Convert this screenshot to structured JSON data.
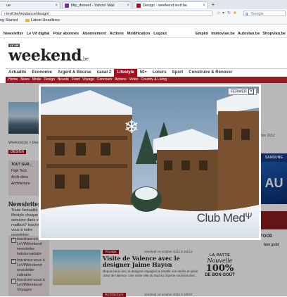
{
  "browser": {
    "tabs": [
      {
        "label": "ue",
        "active": false
      },
      {
        "label": "filip_deneef - Yahoo! Mail",
        "active": false
      },
      {
        "label": "Design - weekend.levif.be",
        "active": true
      }
    ],
    "url": "r.levif.be/tendance/design/",
    "search_placeholder": "Google",
    "bookmarks": [
      "ng Started",
      "Latest Headlines"
    ]
  },
  "site": {
    "topnav_left": [
      "Newsletter",
      "Le Vif digital",
      "Pour abonnés",
      "Abonnement",
      "Actions",
      "Modification",
      "Logout"
    ],
    "topnav_right": [
      "Emploi",
      "Immovlan.be",
      "Autovlan.be",
      "Shopvlan.be"
    ],
    "logo": {
      "badge": "LE VIF",
      "main": "weekend",
      "suffix": ".be"
    },
    "mainnav": [
      "Actualité",
      "Economie",
      "Argent & Bourse",
      "canal Z",
      "Lifestyle",
      "50+",
      "Loisirs",
      "Sport",
      "Construire & Rénover"
    ],
    "mainnav_active": "Lifestyle",
    "subnav": [
      "Home",
      "News",
      "Mode",
      "Design",
      "Beauté",
      "Food",
      "Voyage",
      "Concours",
      "Actions",
      "Video",
      "Country & Living"
    ],
    "breadcrumb": "Weekend.be > Design",
    "design_tag": "DESIGN",
    "tout_sur": {
      "title": "TOUT SUR...",
      "items": [
        "High Tech",
        "Archi-déco",
        "Architecture"
      ]
    },
    "newsletter": {
      "title": "Newsletter",
      "text": "Toute l'actualité lifestyle chaque semaine dans votre mailbox? Inscrivez-vous à notre newsletter.",
      "options": [
        "Inscrivez-vous à LeVifWeekend newsletter hebdomadaire",
        "Inscrivez-vous à LeVifWeekend newsletter culinaire",
        "Inscrivez-vous à LeVifWeekend Voyages"
      ]
    },
    "right": {
      "date": "2 novembre 2012",
      "ad1": "SAMSUNG",
      "ad2": "AU",
      "food": "FOOD",
      "bon_gout": "bon goût"
    },
    "article": {
      "category": "Voyage",
      "date": "vendredi 19 octobre 2012 à 15h15",
      "title": "Visite de Valence avec le designer Jaime Hayon",
      "text": "Depuis deux ans, le designer espagnol a installé son studio en plein cœur de Valence. Une visite ville du Sud au charme sourerai dont..."
    },
    "article2": {
      "category": "Architecture",
      "date": "vendredi 19 octobre 2012 à 10h07"
    },
    "bon_gout_promo": {
      "line1": "LA PATTE",
      "line2": "Nouvelle",
      "line3": "100%",
      "line4": "DE BON GOÛT"
    }
  },
  "lightbox": {
    "close_label": "FERMER",
    "close_icon": "close-icon",
    "brand": "Club Med",
    "snowflake_icon": "snowflake-icon"
  }
}
